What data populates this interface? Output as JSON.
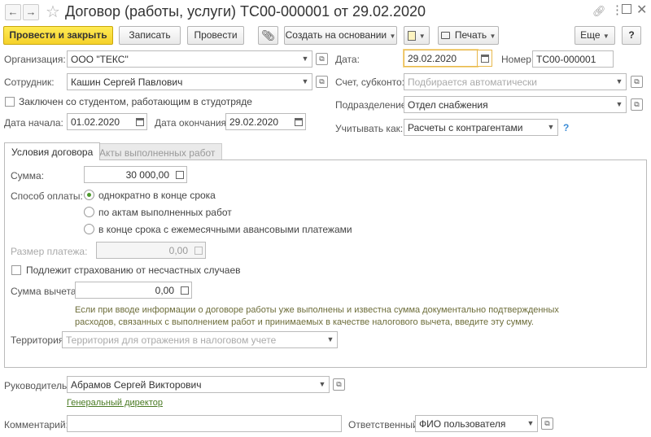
{
  "window": {
    "title": "Договор (работы, услуги) ТС00-000001 от 29.02.2020"
  },
  "toolbar": {
    "post_close": "Провести и закрыть",
    "save": "Записать",
    "post": "Провести",
    "create_based": "Создать на основании",
    "print": "Печать",
    "more": "Еще",
    "help": "?"
  },
  "header": {
    "org_label": "Организация:",
    "org_value": "ООО \"ТЕКС\"",
    "employee_label": "Сотрудник:",
    "employee_value": "Кашин Сергей Павлович",
    "student_label": "Заключен со студентом, работающим в студотряде",
    "start_label": "Дата начала:",
    "start_value": "01.02.2020",
    "end_label": "Дата окончания:",
    "end_value": "29.02.2020",
    "date_label": "Дата:",
    "date_value": "29.02.2020",
    "number_label": "Номер:",
    "number_value": "ТС00-000001",
    "account_label": "Счет, субконто:",
    "account_placeholder": "Подбирается автоматически",
    "dept_label": "Подразделение:",
    "dept_value": "Отдел снабжения",
    "account_as_label": "Учитывать как:",
    "account_as_value": "Расчеты с контрагентами",
    "account_as_help": "?"
  },
  "tabs": {
    "terms": "Условия договора",
    "acts": "Акты выполненных работ"
  },
  "terms": {
    "sum_label": "Сумма:",
    "sum_value": "30 000,00",
    "payment_label": "Способ оплаты:",
    "payment_options": [
      "однократно в конце срока",
      "по актам выполненных работ",
      "в конце срока с ежемесячными авансовыми платежами"
    ],
    "payment_size_label": "Размер платежа:",
    "payment_size_value": "0,00",
    "insurance_label": "Подлежит страхованию от несчастных случаев",
    "deduction_label": "Сумма вычета:",
    "deduction_value": "0,00",
    "hint_line1": "Если при вводе информации о договоре работы уже выполнены и известна сумма документально подтвержденных",
    "hint_line2": "расходов, связанных с выполнением работ и принимаемых в качестве налогового вычета, введите эту сумму.",
    "territory_label": "Территория:",
    "territory_placeholder": "Территория для отражения в налоговом учете"
  },
  "footer": {
    "head_label": "Руководитель:",
    "head_value": "Абрамов Сергей Викторович",
    "head_position": "Генеральный директор",
    "comment_label": "Комментарий:",
    "comment_value": "",
    "responsible_label": "Ответственный:",
    "responsible_value": "ФИО пользователя"
  },
  "colors": {
    "accent_yellow": "#f5d12a",
    "radio_green": "#4c9a2a",
    "link_green": "#4a7a23"
  }
}
